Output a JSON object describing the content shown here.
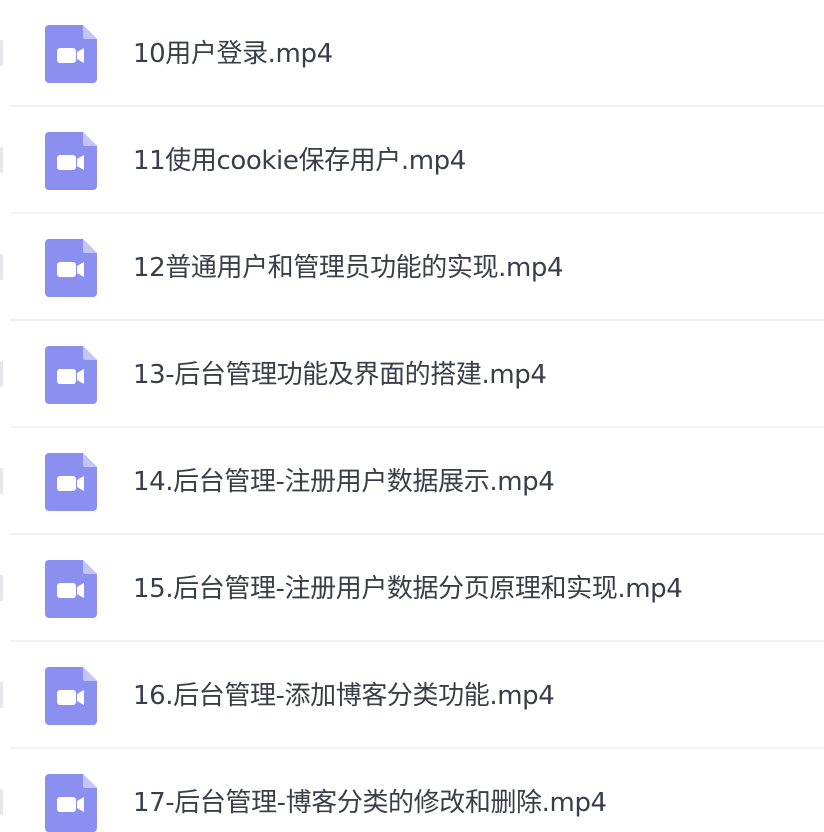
{
  "files": [
    {
      "name": "10用户登录.mp4",
      "icon": "video-file-icon"
    },
    {
      "name": "11使用cookie保存用户.mp4",
      "icon": "video-file-icon"
    },
    {
      "name": "12普通用户和管理员功能的实现.mp4",
      "icon": "video-file-icon"
    },
    {
      "name": "13-后台管理功能及界面的搭建.mp4",
      "icon": "video-file-icon"
    },
    {
      "name": "14.后台管理-注册用户数据展示.mp4",
      "icon": "video-file-icon"
    },
    {
      "name": "15.后台管理-注册用户数据分页原理和实现.mp4",
      "icon": "video-file-icon"
    },
    {
      "name": "16.后台管理-添加博客分类功能.mp4",
      "icon": "video-file-icon"
    },
    {
      "name": "17-后台管理-博客分类的修改和删除.mp4",
      "icon": "video-file-icon"
    }
  ],
  "colors": {
    "icon_body": "#8a8ff0",
    "icon_fold": "#c2c5f7",
    "camera": "#ffffff",
    "text": "#3a3d4a",
    "divider": "#f1f1f4"
  }
}
